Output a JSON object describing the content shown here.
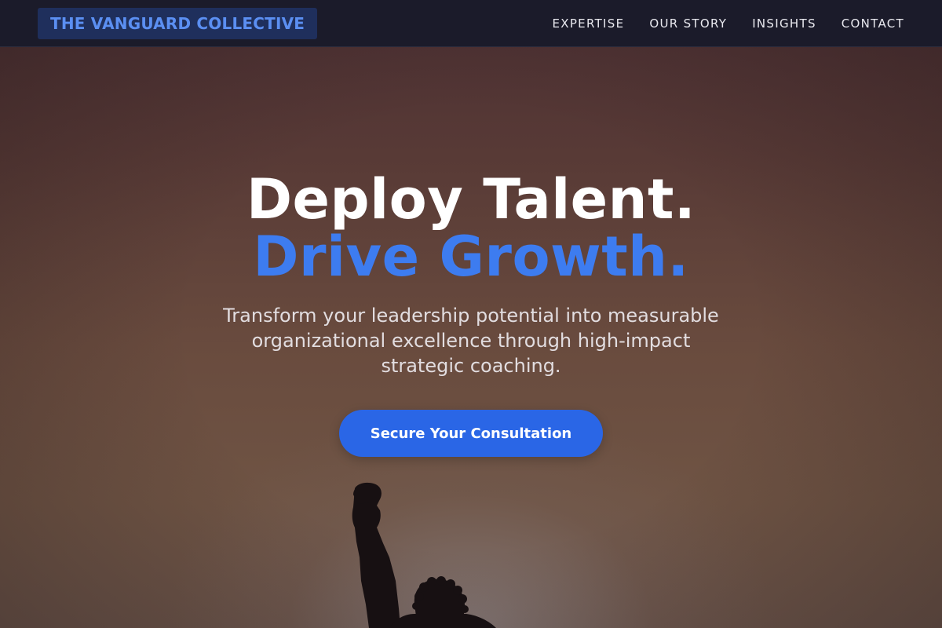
{
  "nav": {
    "brand": "THE VANGUARD COLLECTIVE",
    "links": [
      {
        "label": "EXPERTISE"
      },
      {
        "label": "OUR STORY"
      },
      {
        "label": "INSIGHTS"
      },
      {
        "label": "CONTACT"
      }
    ]
  },
  "hero": {
    "headline_line1": "Deploy Talent.",
    "headline_line2": "Drive Growth.",
    "subtitle": "Transform your leadership potential into measurable organizational excellence through high-impact strategic coaching.",
    "cta_label": "Secure Your Consultation",
    "image_subject": "person-silhouette-raised-fist"
  },
  "colors": {
    "brand_text": "#5b8ff2",
    "brand_bg": "#1f2f5c",
    "nav_bg": "#1b1b2a",
    "accent": "#3d7cf0",
    "cta_bg": "#2a66e6"
  }
}
